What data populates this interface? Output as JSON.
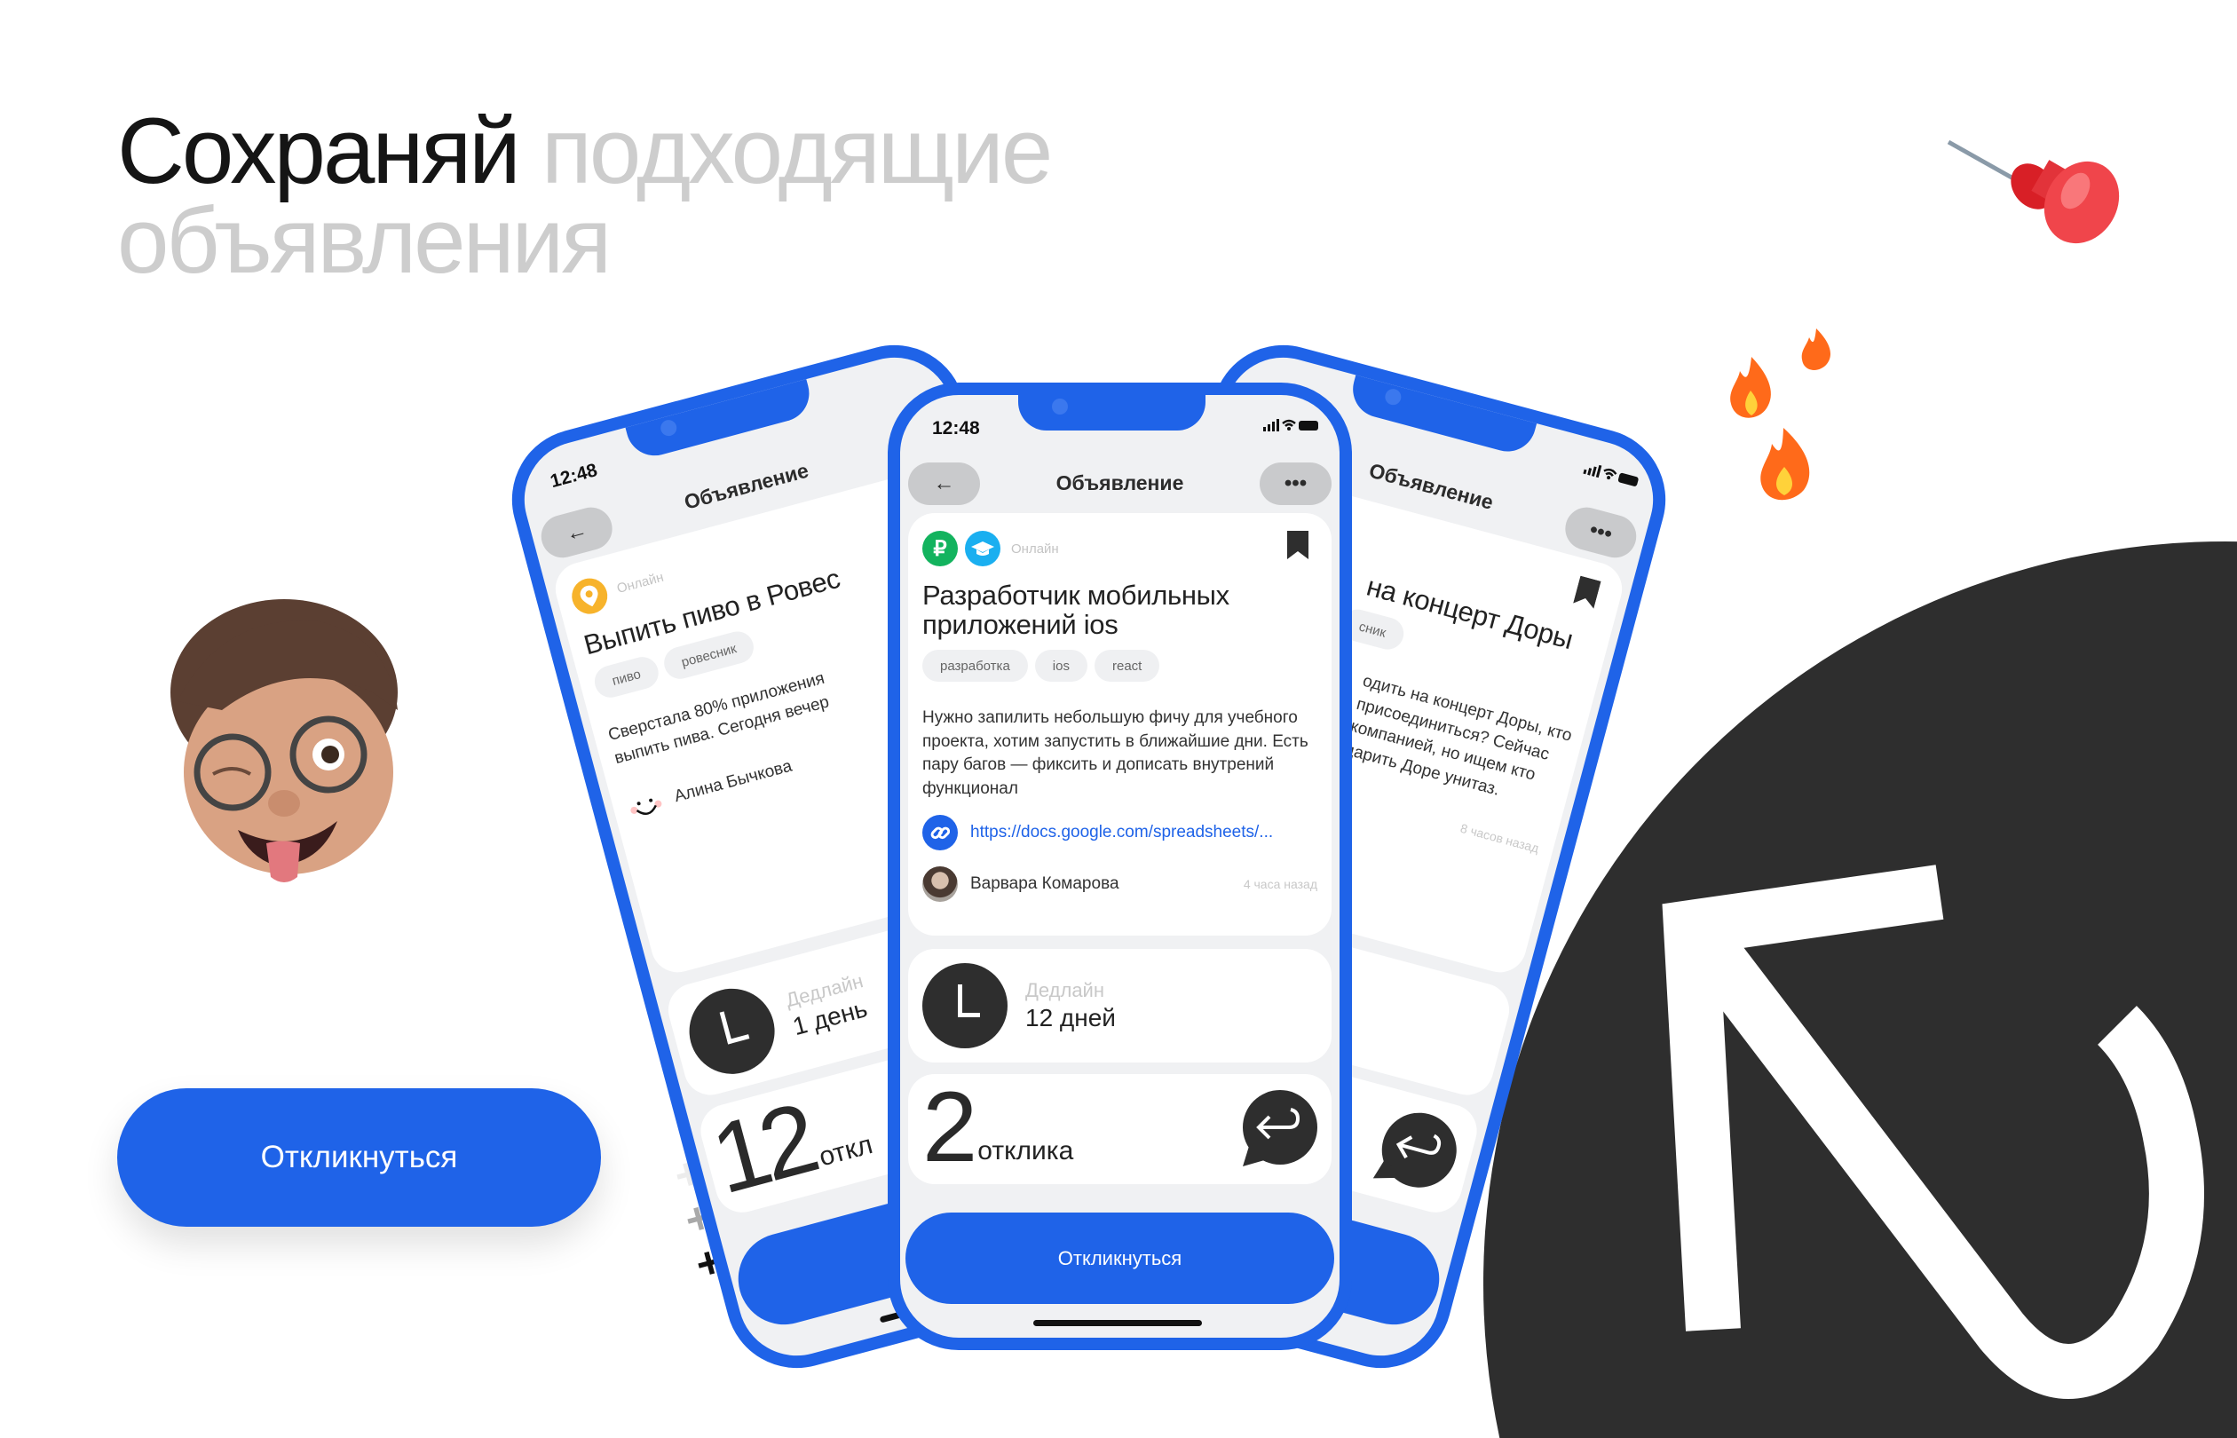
{
  "headline": {
    "dark": "Сохраняй",
    "light_1": "подходящие",
    "light_2": "объявления"
  },
  "cta_button": "Откликнуться",
  "plus_one": [
    "+1",
    "+1",
    "+1"
  ],
  "colors": {
    "accent": "#1F63E8",
    "dark": "#2E2E2E",
    "screen_bg": "#F0F1F3",
    "headline_light": "#CDCDCD"
  },
  "phones": {
    "center": {
      "time": "12:48",
      "header_title": "Объявление",
      "location": "Онлайн",
      "title": "Разработчик мобильных приложений ios",
      "tags": [
        "разработка",
        "ios",
        "react"
      ],
      "description": "Нужно запилить небольшую фичу для учебного проекта, хотим запустить в ближайшие дни. Есть пару багов — фиксить и дописать внутрений функционал",
      "link": "https://docs.google.com/spreadsheets/...",
      "author": "Варвара Комарова",
      "posted": "4 часа назад",
      "deadline_label": "Дедлайн",
      "deadline_value": "12 дней",
      "responses_count": "2",
      "responses_label": "отклика",
      "button": "Откликнуться"
    },
    "left": {
      "time": "12:48",
      "header_title": "Объявление",
      "location": "Онлайн",
      "title": "Выпить пиво в Ровес",
      "tags": [
        "пиво",
        "ровесник"
      ],
      "description_lines": [
        "Сверстала 80% приложения",
        "выпить пива. Сегодня вечер"
      ],
      "author": "Алина Бычкова",
      "deadline_label": "Дедлайн",
      "deadline_value": "1 день",
      "responses_count": "12",
      "responses_label": "откл"
    },
    "right": {
      "header_title": "Объявление",
      "title": "на концерт Доры",
      "tag": "сник",
      "description_lines": [
        "одить на концерт Доры, кто",
        "присоединиться? Сейчас",
        "компанией, но ищем кто",
        "дарить Доре унитаз."
      ],
      "posted": "8 часов назад"
    }
  }
}
